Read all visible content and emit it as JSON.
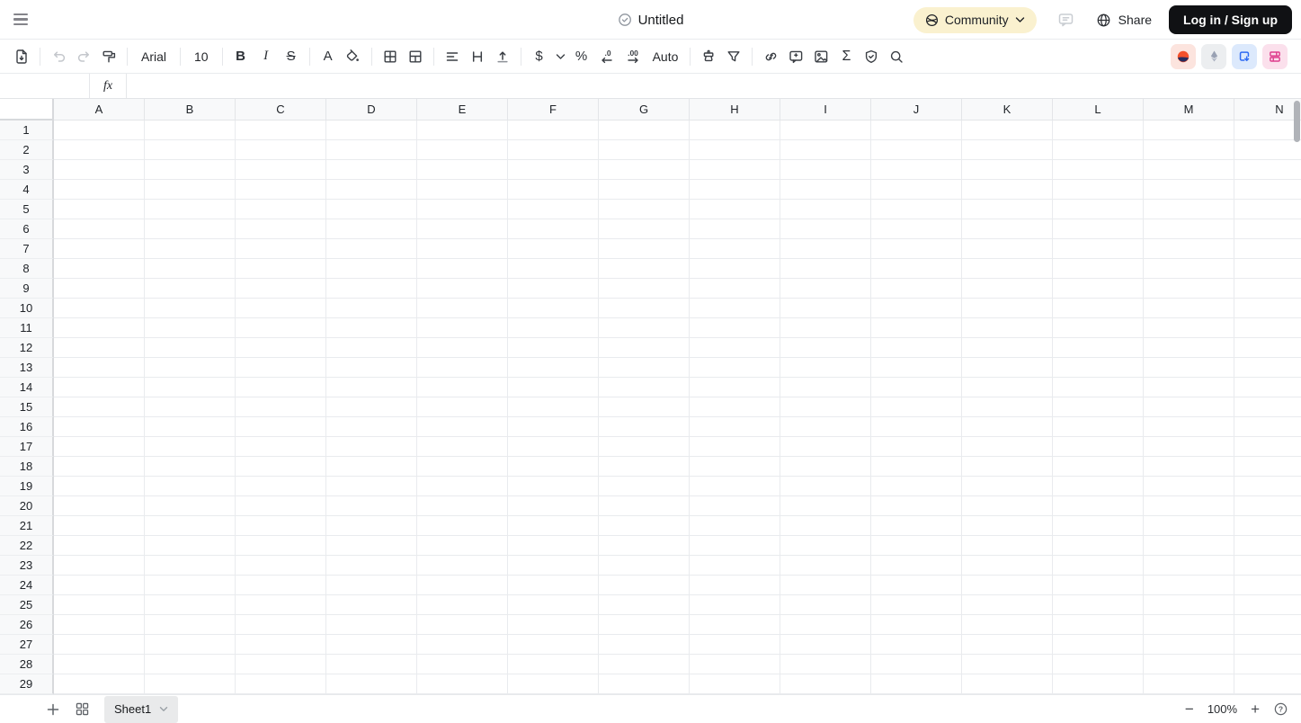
{
  "topbar": {
    "title": "Untitled",
    "community_label": "Community",
    "share_label": "Share",
    "login_label": "Log in / Sign up"
  },
  "toolbar": {
    "font_family": "Arial",
    "font_size": "10",
    "bold_label": "B",
    "italic_label": "I",
    "strikethrough_label": "S",
    "text_color_label": "A",
    "currency_label": "$",
    "percent_label": "%",
    "decrease_decimal_label": ".0",
    "increase_decimal_label": ".00",
    "auto_format_label": "Auto",
    "sum_label": "Σ"
  },
  "formula_bar": {
    "name_box_value": "",
    "fx_label": "fx",
    "input_value": ""
  },
  "grid": {
    "columns": [
      "A",
      "B",
      "C",
      "D",
      "E",
      "F",
      "G",
      "H",
      "I",
      "J",
      "K",
      "L",
      "M",
      "N"
    ],
    "rows": [
      "1",
      "2",
      "3",
      "4",
      "5",
      "6",
      "7",
      "8",
      "9",
      "10",
      "11",
      "12",
      "13",
      "14",
      "15",
      "16",
      "17",
      "18",
      "19",
      "20",
      "21",
      "22",
      "23",
      "24",
      "25",
      "26",
      "27",
      "28",
      "29"
    ]
  },
  "footer": {
    "sheet_tab_label": "Sheet1",
    "zoom_out_label": "−",
    "zoom_level": "100%",
    "zoom_in_label": "+",
    "help_label": "?"
  },
  "colors": {
    "community_pill_bg": "#faf1cf",
    "login_btn_bg": "#101114",
    "chip_salmon_bg": "#fce4de",
    "chip_gray_bg": "#eceef0",
    "chip_blue_bg": "#dce9fc",
    "chip_pink_bg": "#fbe0ec",
    "brand_orange": "#f4512c",
    "brand_navy": "#272c5e",
    "eth_gray": "#99a1b3",
    "chip_blue_icon": "#2f6bf3",
    "chip_pink_icon": "#de3d8d",
    "header_bg": "#f8f9fa",
    "gridline": "#e9ebee"
  }
}
